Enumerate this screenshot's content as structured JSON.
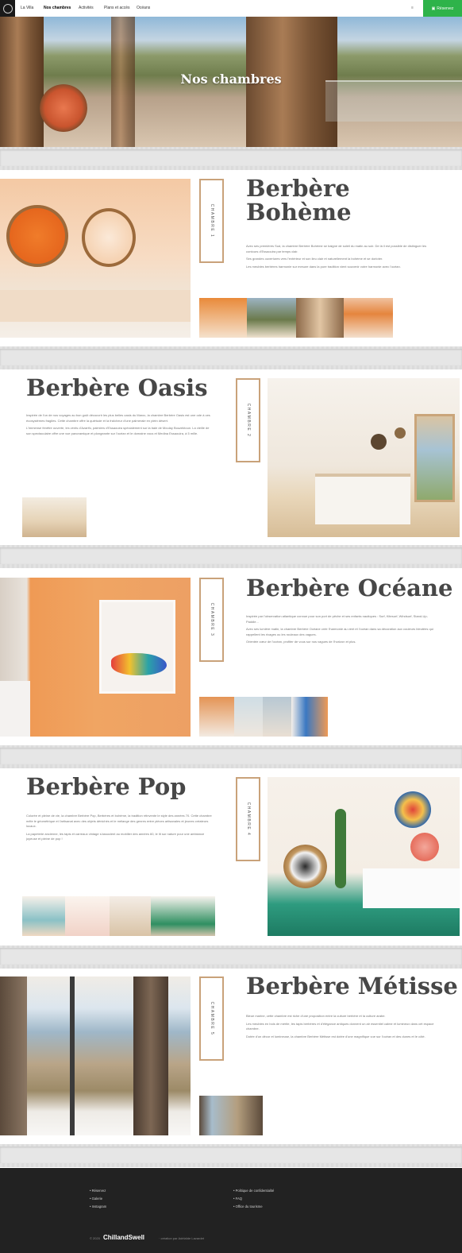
{
  "header": {
    "nav": [
      "La Villa",
      "Nos chambres",
      "Activités",
      "Plans et accès",
      "Océans"
    ],
    "active_index": 1,
    "lang_label": "≡",
    "reserve_label": "Réservez"
  },
  "hero": {
    "title": "Nos chambres"
  },
  "rooms": [
    {
      "tag": "CHAMBRE 1",
      "title": "Berbère\nBohème",
      "paragraphs": [
        "Avec ses premières Sud, la chambre Berbère Bohème se baigne de soleil du matin au soir. De là il est possible de distinguer les contours d'Essaouira par temps clair.",
        "Ses grandes ouvertures vers l'extérieur et son lieu clair et naturellement la bohème et se dorloter.",
        "Les meubles berbères harmonie sur mesure dans la pure tradition vient souvenir votre harmonie avec l'océan."
      ]
    },
    {
      "tag": "CHAMBRE 2",
      "title": "Berbère Oasis",
      "paragraphs": [
        "Inspirée de l'un de nos voyages au bon goût découvrir les plus belles oasis du Maroc, la chambre Berbère Oasis est une ode à ces écosystèmes fragiles. Cette chambre offre la quiétude et la fraîcheur d'une palmeraie en plein désert.",
        "L'immense fenêtre ouverte, les vents d'Azarifo, palmiers d'Essaouira spécialement sur la baie de Moulay Bouzektoun. La vieille de son spectaculaire offre une vue panoramique et plongeante sur l'océan et le domaine vous et Medina Essaouira, à 5 mille."
      ]
    },
    {
      "tag": "CHAMBRE 3",
      "title": "Berbère Océane",
      "paragraphs": [
        "Inspirée par l'observation atlantique connue pour son port de pêche et ses enfants nautiques : Surf, Kitesurf, Windsurf, Stand-Up-Paddle...",
        "Avec ses lumière matin, la chambre Berbère Océane crée l'harmonie au vent et l'océan dans sa décoration aux couleurs bleutées qui rappellent les rivages ou les rouleaux des vagues.",
        "Orientée cœur de l'océan, profiter de vous sur nos vagues de l'horizon et plus."
      ]
    },
    {
      "tag": "CHAMBRE 4",
      "title": "Berbère Pop",
      "paragraphs": [
        "Colorée et pleine de vie, la chambre Berbère Pop, Berbères et bohème, la tradition réinvente le style des années 70. Cette chambre mêle le géométrique et l'artisanat avec des objets dénichés et le mélange des genres entre pièces artisanales et jeunes créateurs locaux.",
        "La papeterie ancienne, les tapis et carreaux vintage s'associent au mobilier des années 60, le lit sur nature pour une ambiance joyeuse et pleine de pop !"
      ]
    },
    {
      "tag": "CHAMBRE 5",
      "title": "Berbère Métisse",
      "paragraphs": [
        "Bleue marine, cette chambre est riche d'une proposition entre la culture berbère et la culture arabe.",
        "Les meubles en bois de mérite, les tapis berbères et d'élégance antiques donnent un air essentiel calme et lumineux dans cet espace chambre.",
        "Dotée d'un décor et lumineuse, la chambre Berbère Métisse est dotée d'une magnifique vue sur l'océan et des dunes et le côté."
      ]
    }
  ],
  "footer": {
    "col1": [
      "Réservez",
      "Galerie",
      "Instagram"
    ],
    "col2": [
      "Politique de confidentialité",
      "FAQ",
      "Office du tourisme"
    ],
    "copyright": "© 2020",
    "brand": "ChillandSwell",
    "credit": "· création par Adélaïde Lavardet"
  },
  "colors": {
    "accent": "#2eb34a",
    "footer_bg": "#222222",
    "title": "#474747",
    "tag_border": "#c9a27a"
  }
}
